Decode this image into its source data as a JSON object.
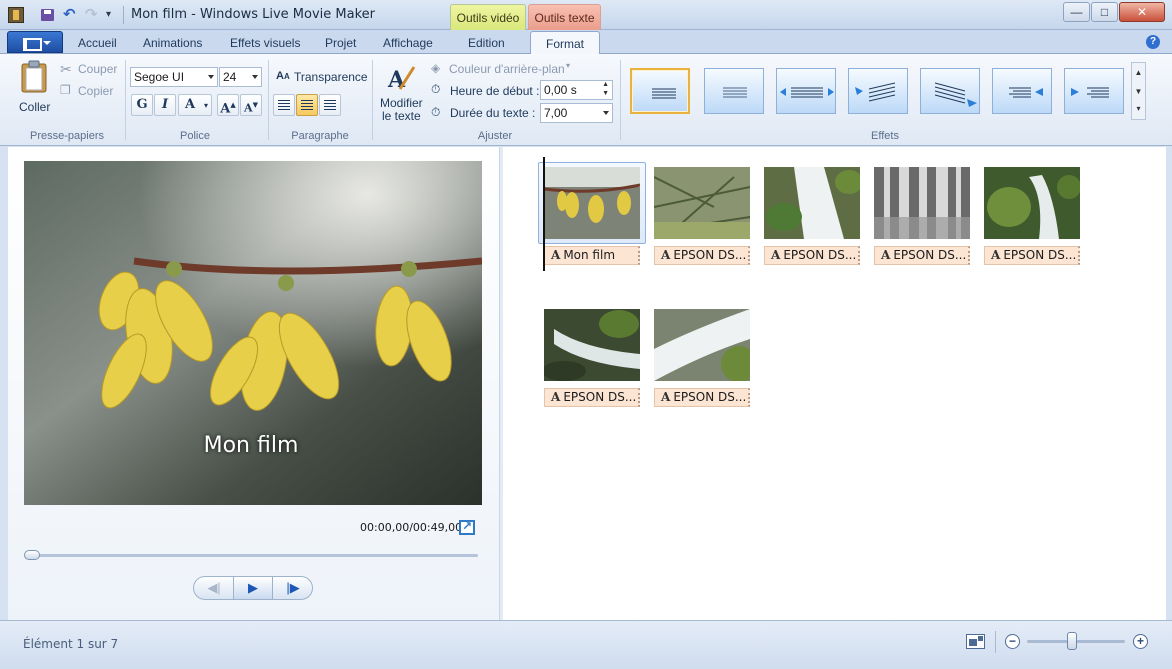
{
  "window": {
    "title": "Mon film - Windows Live Movie Maker",
    "context_tabs": {
      "video": "Outils vidéo",
      "text": "Outils texte"
    },
    "controls": {
      "minimize": "—",
      "maximize": "□",
      "close": "✕"
    }
  },
  "quick_access": {
    "undo": "↶",
    "redo": "↷",
    "more": "▾"
  },
  "tabs": [
    {
      "label": "Accueil"
    },
    {
      "label": "Animations"
    },
    {
      "label": "Effets visuels"
    },
    {
      "label": "Projet"
    },
    {
      "label": "Affichage"
    },
    {
      "label": "Edition"
    },
    {
      "label": "Format",
      "active": true
    }
  ],
  "help": "?",
  "ribbon": {
    "clipboard": {
      "paste": "Coller",
      "cut": "Couper",
      "copy": "Copier",
      "group": "Presse-papiers"
    },
    "font": {
      "family": "Segoe UI",
      "size": "24",
      "bold": "G",
      "italic": "I",
      "color": "A",
      "grow": "A",
      "shrink": "A",
      "group": "Police"
    },
    "paragraph": {
      "transparency": "Transparence",
      "group": "Paragraphe",
      "align_selected": "center"
    },
    "adjust": {
      "edit_text": "Modifier",
      "edit_text_2": "le texte",
      "bg_color": "Couleur d'arrière-plan",
      "start_time_label": "Heure de début :",
      "start_time_value": "0,00 s",
      "duration_label": "Durée du texte :",
      "duration_value": "7,00",
      "group": "Ajuster"
    },
    "effects": {
      "group": "Effets",
      "count": 7,
      "selected_index": 0
    }
  },
  "preview": {
    "overlay_title": "Mon film",
    "time": "00:00,00/00:49,00",
    "progress": 0,
    "controls": {
      "prev": "◀|",
      "play": "▶",
      "next": "|▶"
    }
  },
  "storyboard": {
    "clips": [
      {
        "caption": "Mon film",
        "thumb": "forsythia"
      },
      {
        "caption": "EPSON DS...",
        "thumb": "branches"
      },
      {
        "caption": "EPSON DS...",
        "thumb": "waterfall"
      },
      {
        "caption": "EPSON DS...",
        "thumb": "waterfall-gray"
      },
      {
        "caption": "EPSON DS...",
        "thumb": "stream"
      },
      {
        "caption": "EPSON DS...",
        "thumb": "stream-rocks"
      },
      {
        "caption": "EPSON DS...",
        "thumb": "waterfall-2"
      }
    ]
  },
  "status": {
    "text": "Élément 1 sur 7",
    "zoom_out": "−",
    "zoom_in": "+",
    "zoom_level": 0.45
  },
  "colors": {
    "accent": "#2f6fd0",
    "selection": "#e9b23f",
    "caption_bg": "#fde5d4"
  }
}
